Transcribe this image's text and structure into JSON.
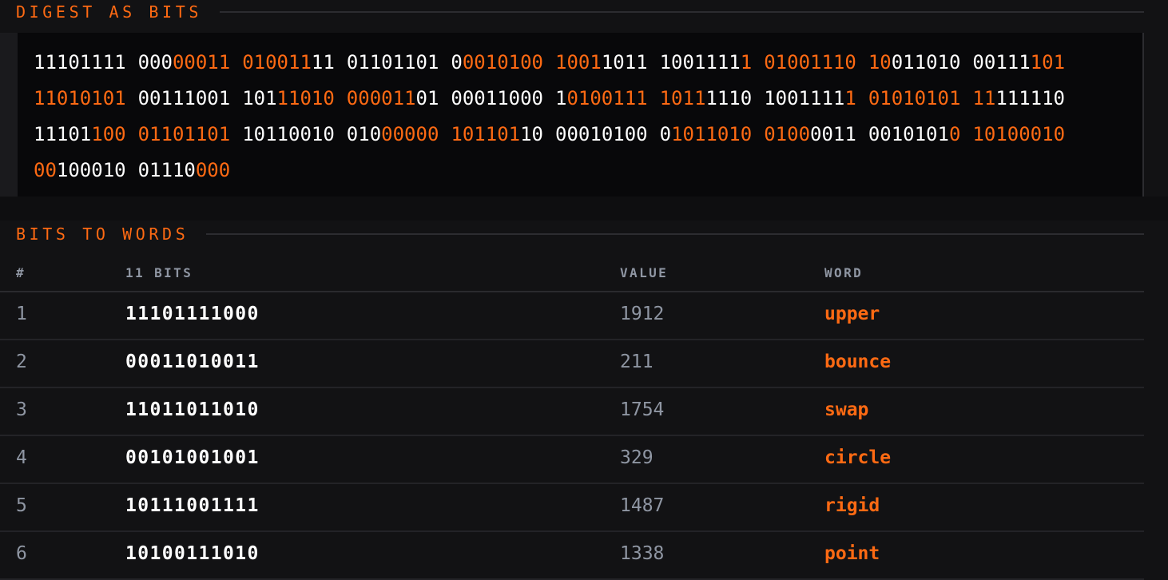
{
  "sections": {
    "digest_title": "DIGEST AS BITS",
    "words_title": "BITS TO WORDS"
  },
  "digest_lines": [
    [
      [
        [
          "11101111",
          0
        ]
      ],
      [
        [
          "000",
          0
        ],
        [
          "00011",
          1
        ]
      ],
      [
        [
          "010011",
          1
        ],
        [
          "11",
          0
        ]
      ],
      [
        [
          "01101101",
          0
        ]
      ],
      [
        [
          "0",
          0
        ],
        [
          "0010100",
          1
        ]
      ],
      [
        [
          "1001",
          1
        ],
        [
          "1011",
          0
        ]
      ],
      [
        [
          "1001111",
          0
        ],
        [
          "1",
          1
        ]
      ],
      [
        [
          "01001110",
          1
        ]
      ],
      [
        [
          "10",
          1
        ],
        [
          "011010",
          0
        ]
      ],
      [
        [
          "00111",
          0
        ],
        [
          "101",
          1
        ]
      ]
    ],
    [
      [
        [
          "11010101",
          1
        ]
      ],
      [
        [
          "00111001",
          0
        ]
      ],
      [
        [
          "101",
          0
        ],
        [
          "11010",
          1
        ]
      ],
      [
        [
          "000011",
          1
        ],
        [
          "01",
          0
        ]
      ],
      [
        [
          "00011000",
          0
        ]
      ],
      [
        [
          "1",
          0
        ],
        [
          "0100111",
          1
        ]
      ],
      [
        [
          "1011",
          1
        ],
        [
          "1110",
          0
        ]
      ],
      [
        [
          "1001111",
          0
        ],
        [
          "1",
          1
        ]
      ],
      [
        [
          "01010101",
          1
        ]
      ],
      [
        [
          "11",
          1
        ],
        [
          "111110",
          0
        ]
      ]
    ],
    [
      [
        [
          "11101",
          0
        ],
        [
          "100",
          1
        ]
      ],
      [
        [
          "01101101",
          1
        ]
      ],
      [
        [
          "10110010",
          0
        ]
      ],
      [
        [
          "010",
          0
        ],
        [
          "00000",
          1
        ]
      ],
      [
        [
          "101101",
          1
        ],
        [
          "10",
          0
        ]
      ],
      [
        [
          "00010100",
          0
        ]
      ],
      [
        [
          "0",
          0
        ],
        [
          "1011010",
          1
        ]
      ],
      [
        [
          "0100",
          1
        ],
        [
          "0011",
          0
        ]
      ],
      [
        [
          "0010101",
          0
        ],
        [
          "0",
          1
        ]
      ],
      [
        [
          "10100010",
          1
        ]
      ]
    ],
    [
      [
        [
          "00",
          1
        ],
        [
          "100010",
          0
        ]
      ],
      [
        [
          "01110",
          0
        ],
        [
          "000",
          1
        ]
      ]
    ]
  ],
  "table": {
    "headers": {
      "num": "#",
      "bits": "11 BITS",
      "value": "VALUE",
      "word": "WORD"
    },
    "rows": [
      {
        "num": "1",
        "bits": "11101111000",
        "value": "1912",
        "word": "upper"
      },
      {
        "num": "2",
        "bits": "00011010011",
        "value": "211",
        "word": "bounce"
      },
      {
        "num": "3",
        "bits": "11011011010",
        "value": "1754",
        "word": "swap"
      },
      {
        "num": "4",
        "bits": "00101001001",
        "value": "329",
        "word": "circle"
      },
      {
        "num": "5",
        "bits": "10111001111",
        "value": "1487",
        "word": "rigid"
      },
      {
        "num": "6",
        "bits": "10100111010",
        "value": "1338",
        "word": "point"
      }
    ]
  },
  "colors": {
    "accent": "#ff6a13",
    "text": "#ffffff",
    "muted": "#8f96a3",
    "background": "#121214"
  }
}
